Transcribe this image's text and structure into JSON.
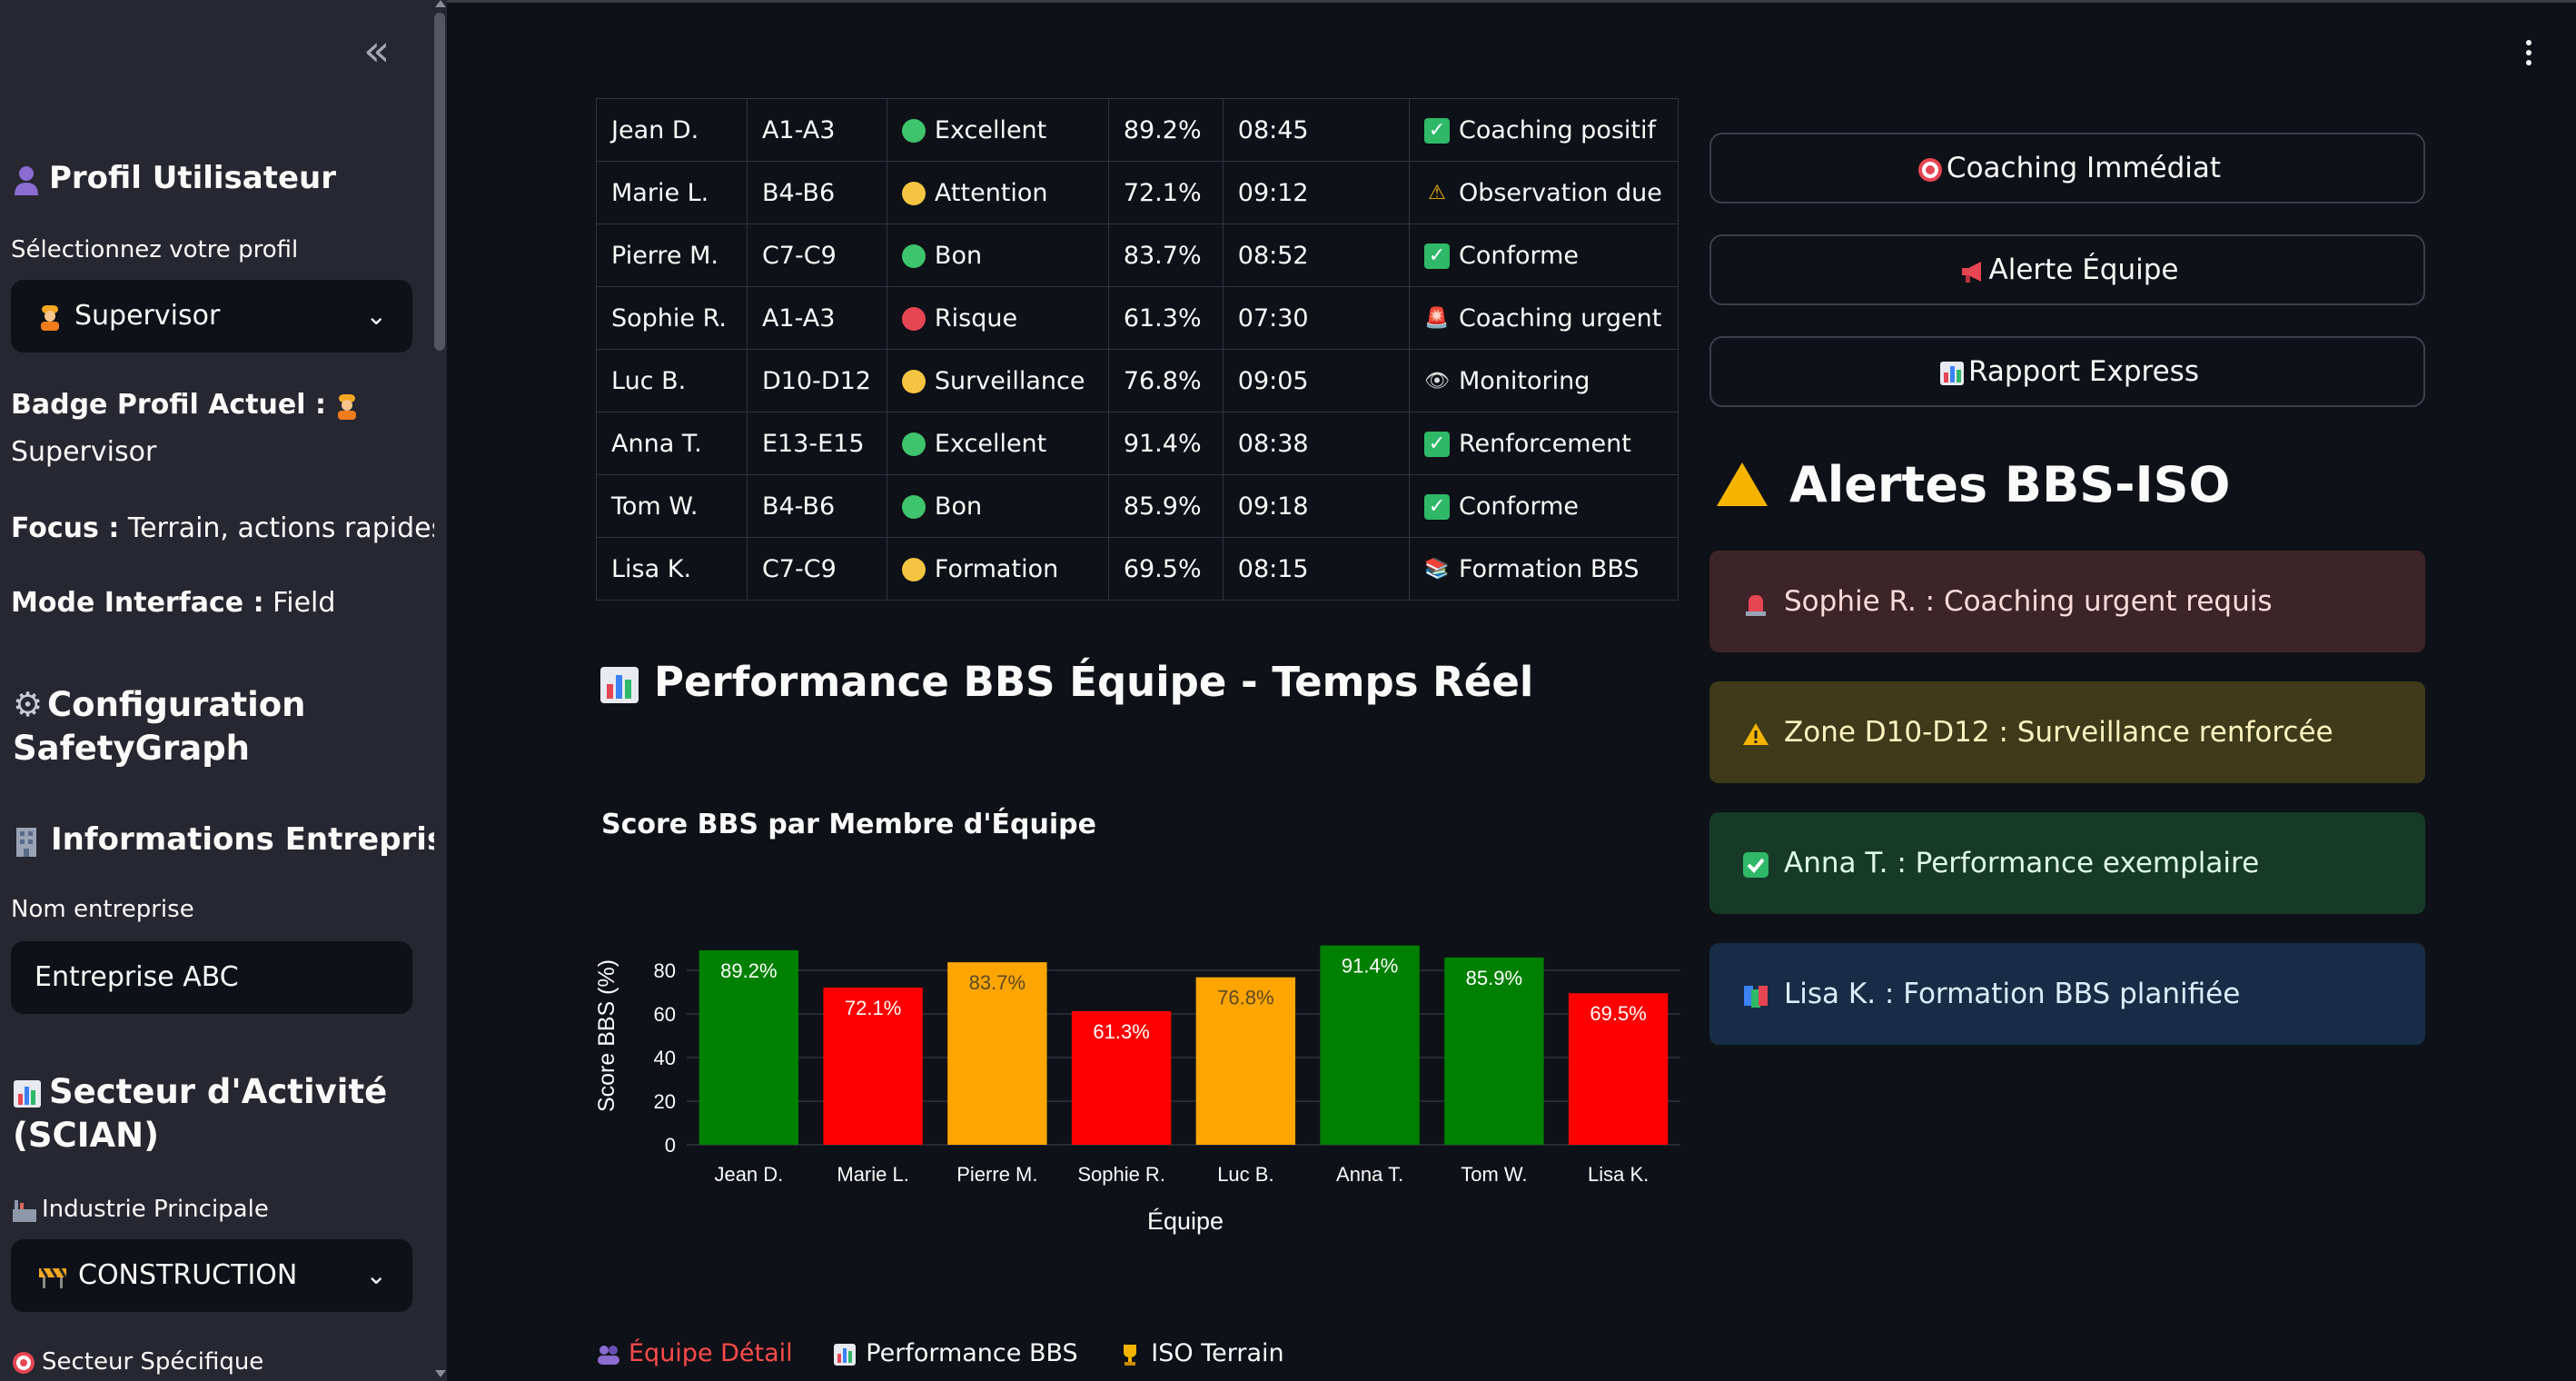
{
  "sidebar": {
    "profile_header": "Profil Utilisateur",
    "profile_select_label": "Sélectionnez votre profil",
    "profile_selected": "Supervisor",
    "badge_label": "Badge Profil Actuel :",
    "badge_value": "Supervisor",
    "focus_label": "Focus :",
    "focus_value": "Terrain, actions rapides",
    "mode_label": "Mode Interface :",
    "mode_value": "Field",
    "config_header_line1": "Configuration",
    "config_header_line2": "SafetyGraph",
    "company_header": "Informations Entreprise",
    "company_label": "Nom entreprise",
    "company_value": "Entreprise ABC",
    "sector_header_line1": "Secteur d'Activité",
    "sector_header_line2": "(SCIAN)",
    "industry_label": "Industrie Principale",
    "industry_selected": "CONSTRUCTION",
    "specific_label": "Secteur Spécifique"
  },
  "team_table": {
    "rows": [
      {
        "name": "Jean D.",
        "zone": "A1-A3",
        "status": "Excellent",
        "status_color": "green",
        "score": "89.2%",
        "time": "08:45",
        "action": "Coaching positif",
        "action_icon": "check-icon"
      },
      {
        "name": "Marie L.",
        "zone": "B4-B6",
        "status": "Attention",
        "status_color": "yellow",
        "score": "72.1%",
        "time": "09:12",
        "action": "Observation due",
        "action_icon": "warning-icon"
      },
      {
        "name": "Pierre M.",
        "zone": "C7-C9",
        "status": "Bon",
        "status_color": "green",
        "score": "83.7%",
        "time": "08:52",
        "action": "Conforme",
        "action_icon": "check-icon"
      },
      {
        "name": "Sophie R.",
        "zone": "A1-A3",
        "status": "Risque",
        "status_color": "red",
        "score": "61.3%",
        "time": "07:30",
        "action": "Coaching urgent",
        "action_icon": "siren-icon"
      },
      {
        "name": "Luc B.",
        "zone": "D10-D12",
        "status": "Surveillance",
        "status_color": "yellow",
        "score": "76.8%",
        "time": "09:05",
        "action": "Monitoring",
        "action_icon": "eye-icon"
      },
      {
        "name": "Anna T.",
        "zone": "E13-E15",
        "status": "Excellent",
        "status_color": "green",
        "score": "91.4%",
        "time": "08:38",
        "action": "Renforcement",
        "action_icon": "check-icon"
      },
      {
        "name": "Tom W.",
        "zone": "B4-B6",
        "status": "Bon",
        "status_color": "green",
        "score": "85.9%",
        "time": "09:18",
        "action": "Conforme",
        "action_icon": "check-icon"
      },
      {
        "name": "Lisa K.",
        "zone": "C7-C9",
        "status": "Formation",
        "status_color": "yellow",
        "score": "69.5%",
        "time": "08:15",
        "action": "Formation BBS",
        "action_icon": "books-icon"
      }
    ]
  },
  "performance": {
    "section_title": "Performance BBS Équipe - Temps Réel"
  },
  "chart_data": {
    "type": "bar",
    "title": "Score BBS par Membre d'Équipe",
    "xlabel": "Équipe",
    "ylabel": "Score BBS (%)",
    "categories": [
      "Jean D.",
      "Marie L.",
      "Pierre M.",
      "Sophie R.",
      "Luc B.",
      "Anna T.",
      "Tom W.",
      "Lisa K."
    ],
    "values": [
      89.2,
      72.1,
      83.7,
      61.3,
      76.8,
      91.4,
      85.9,
      69.5
    ],
    "data_labels": [
      "89.2%",
      "72.1%",
      "83.7%",
      "61.3%",
      "76.8%",
      "91.4%",
      "85.9%",
      "69.5%"
    ],
    "bar_colors": [
      "#008000",
      "#ff0000",
      "#ffa500",
      "#ff0000",
      "#ffa500",
      "#008000",
      "#008000",
      "#ff0000"
    ],
    "yticks": [
      "0",
      "20",
      "40",
      "60",
      "80"
    ],
    "ylim": [
      0,
      100
    ],
    "grid": true
  },
  "tabs": [
    {
      "label": "Équipe Détail",
      "active": true
    },
    {
      "label": "Performance BBS",
      "active": false
    },
    {
      "label": "ISO Terrain",
      "active": false
    }
  ],
  "actions": {
    "coaching": "Coaching Immédiat",
    "alert_team": "Alerte Équipe",
    "report": "Rapport Express"
  },
  "alerts": {
    "title": "Alertes BBS-ISO",
    "items": [
      {
        "text": "Sophie R. : Coaching urgent requis",
        "level": "error"
      },
      {
        "text": "Zone D10-D12 : Surveillance renforcée",
        "level": "warning"
      },
      {
        "text": "Anna T. : Performance exemplaire",
        "level": "success"
      },
      {
        "text": "Lisa K. : Formation BBS planifiée",
        "level": "info"
      }
    ]
  }
}
